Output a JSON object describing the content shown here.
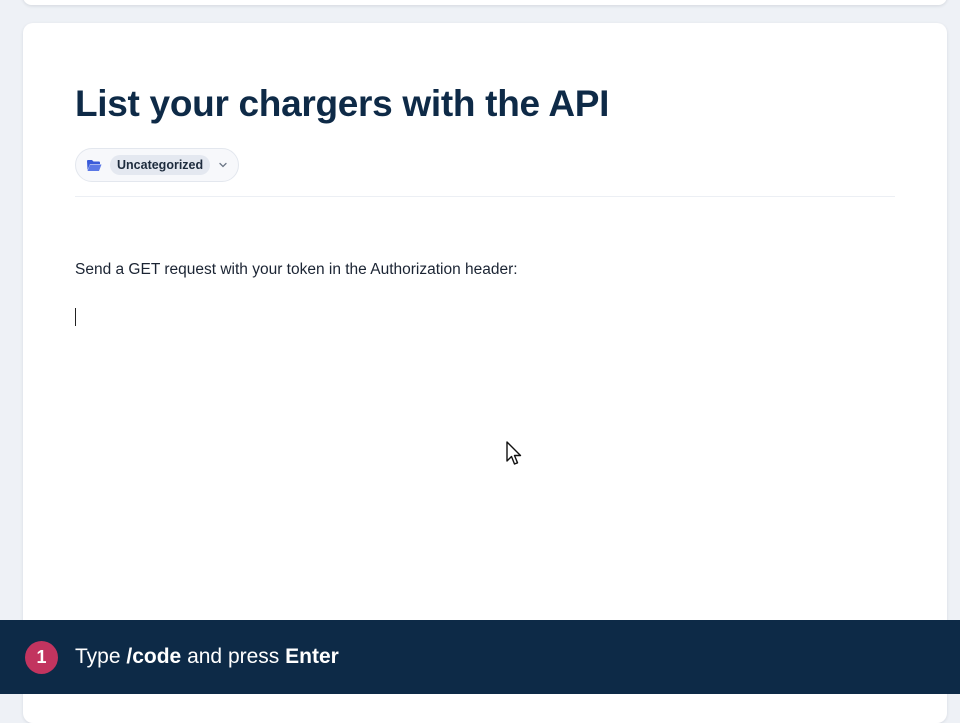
{
  "page": {
    "title": "List your chargers with the API",
    "category": {
      "label": "Uncategorized",
      "icon": "folder-open-icon",
      "icon_color": "#3a5bd9"
    },
    "body_text": "Send a GET request with your token in the Authorization header:"
  },
  "tutorial": {
    "step_number": "1",
    "instruction_prefix": "Type ",
    "command": "/code",
    "instruction_middle": " and press ",
    "key": "Enter",
    "badge_color": "#c2345f",
    "bar_color": "#0d2a47"
  }
}
